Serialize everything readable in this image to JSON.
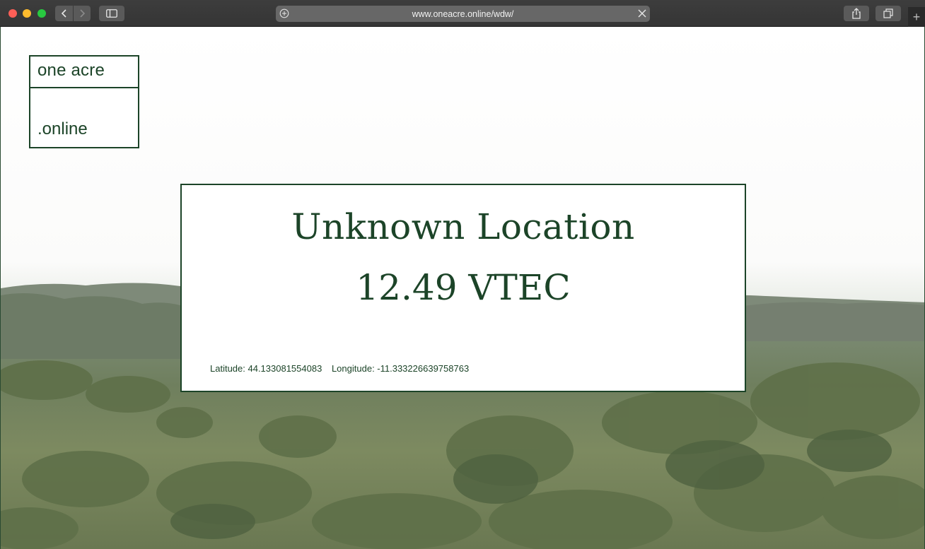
{
  "browser": {
    "url": "www.oneacre.online/wdw/"
  },
  "icons": {
    "back": "chevron-left-icon",
    "forward": "chevron-right-icon",
    "sidebar": "sidebar-icon",
    "share": "share-icon",
    "tabs": "tabs-overview-icon",
    "new_tab": "plus-icon",
    "address_left": "plus-circle-icon",
    "address_stop": "close-icon"
  },
  "logo": {
    "line1": "one acre",
    "line2": ".online"
  },
  "card": {
    "title": "Unknown Location",
    "value": "12.49 VTEC",
    "latitude": "Latitude: 44.133081554083",
    "longitude": "Longitude: -11.333226639758763"
  },
  "colors": {
    "brand": "#1c4428",
    "chrome": "#3a3a3a",
    "address_bar": "#676767"
  }
}
